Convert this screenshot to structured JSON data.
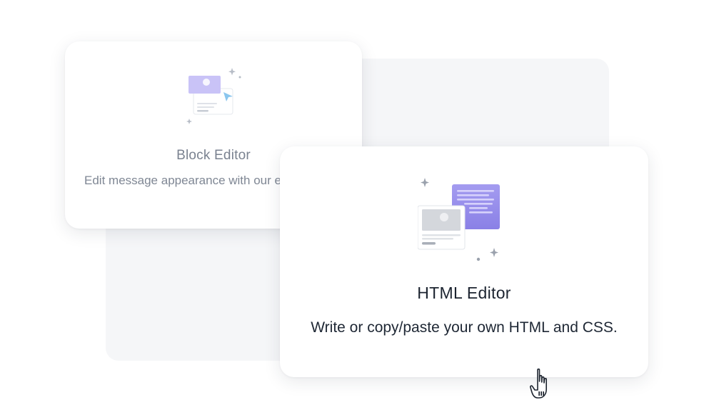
{
  "options": [
    {
      "id": "block",
      "title": "Block Editor",
      "description": "Edit message appearance with our editing tools.",
      "icon": "block-editor-illustration"
    },
    {
      "id": "html",
      "title": "HTML Editor",
      "description": "Write or copy/paste your own HTML and CSS.",
      "icon": "html-editor-illustration"
    }
  ],
  "colors": {
    "accent_purple": "#8f86ea",
    "accent_purple_light": "#c8c2f8",
    "backdrop": "#f5f6f8",
    "card": "#ffffff"
  },
  "cursor": "hand-pointer-icon"
}
